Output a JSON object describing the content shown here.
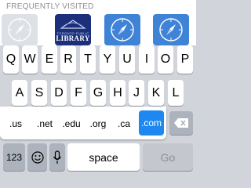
{
  "frequently_visited": {
    "title": "FREQUENTLY VISITED",
    "tiles": [
      {
        "name": "compass-tile"
      },
      {
        "name": "library-tile",
        "sub": "TORONTO PUBLIC",
        "text": "LIBRARY"
      },
      {
        "name": "compass-tile"
      },
      {
        "name": "compass-tile"
      }
    ]
  },
  "keyboard": {
    "row1": [
      "Q",
      "W",
      "E",
      "R",
      "T",
      "Y",
      "U",
      "I",
      "O",
      "P"
    ],
    "row2": [
      "A",
      "S",
      "D",
      "F",
      "G",
      "H",
      "J",
      "K",
      "L"
    ],
    "domains": [
      ".us",
      ".net",
      ".edu",
      ".org",
      ".ca",
      ".com"
    ],
    "selected_domain": ".com",
    "numbers_label": "123",
    "space_label": "space",
    "go_label": "Go"
  },
  "colors": {
    "accent": "#1e88f0",
    "tile_blue": "#3f83d6",
    "library_navy": "#1c2f7a"
  }
}
